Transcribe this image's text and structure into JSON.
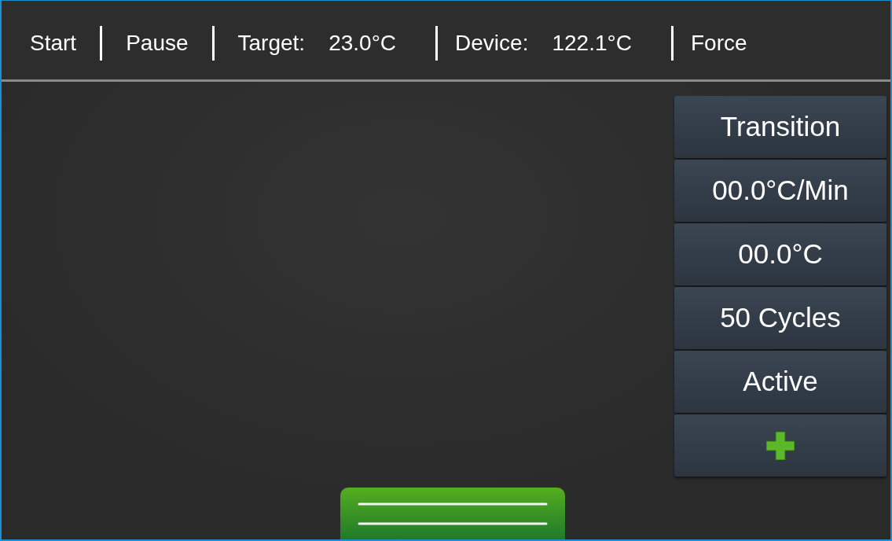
{
  "toolbar": [
    {
      "kind": "button",
      "label": "Start"
    },
    {
      "kind": "button",
      "label": "Pause"
    },
    {
      "kind": "reading",
      "label": "Target:",
      "value": "23.0°C"
    },
    {
      "kind": "reading",
      "label": "Device:",
      "value": "122.1°C"
    },
    {
      "kind": "button",
      "label": "Force"
    }
  ],
  "step_panel": [
    {
      "kind": "text",
      "label": "Transition"
    },
    {
      "kind": "text",
      "label": "00.0°C/Min"
    },
    {
      "kind": "text",
      "label": "00.0°C"
    },
    {
      "kind": "text",
      "label": "50 Cycles"
    },
    {
      "kind": "text",
      "label": "Active"
    },
    {
      "kind": "add"
    }
  ],
  "drawer_handle": {
    "kind": "lines"
  }
}
